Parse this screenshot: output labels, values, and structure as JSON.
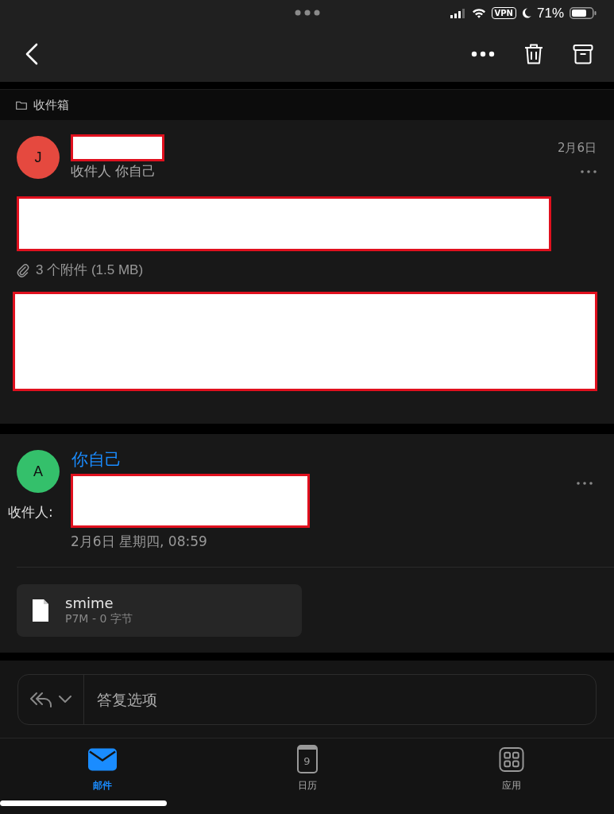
{
  "status_bar": {
    "battery": "71%",
    "vpn": "VPN"
  },
  "breadcrumb": {
    "folder": "收件箱"
  },
  "messages": [
    {
      "avatar": "J",
      "color": "#e5493f",
      "recipient_line": "收件人 你自己",
      "date": "2月6日",
      "attachments": "3 个附件 (1.5 MB)"
    },
    {
      "avatar": "A",
      "color": "#34c06b",
      "sender": "你自己",
      "to_label": "收件人:",
      "datetime": "2月6日 星期四, 08:59",
      "file": {
        "name": "smime",
        "meta": "P7M - 0 字节"
      }
    }
  ],
  "reply": {
    "placeholder": "答复选项"
  },
  "tabs": [
    {
      "label": "邮件",
      "kind": "mail",
      "selected": true
    },
    {
      "label": "日历",
      "kind": "calendar",
      "day": "9",
      "selected": false
    },
    {
      "label": "应用",
      "kind": "apps",
      "selected": false
    }
  ]
}
